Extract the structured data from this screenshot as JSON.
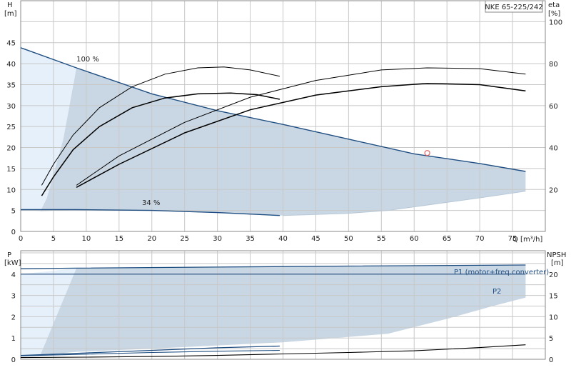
{
  "chart_data": [
    {
      "type": "line",
      "title": "NKE 65-225/242",
      "x_unit_label": "Q [m³/h]",
      "y_left_label": "H",
      "y_left_unit": "[m]",
      "y_right_label": "eta",
      "y_right_unit": "[%]",
      "xlim": [
        0,
        80
      ],
      "ylim_left": [
        0,
        55
      ],
      "ylim_right": [
        0,
        110
      ],
      "x_ticks": [
        "0",
        "5",
        "10",
        "15",
        "20",
        "25",
        "30",
        "35",
        "40",
        "45",
        "50",
        "55",
        "60",
        "65",
        "70",
        "75"
      ],
      "y_left_ticks": [
        "0",
        "5",
        "10",
        "15",
        "20",
        "25",
        "30",
        "35",
        "40",
        "45"
      ],
      "y_right_ticks": [
        "20",
        "40",
        "60",
        "80",
        "100"
      ],
      "grid": true,
      "colors": {
        "envelope": "#c9d7e4",
        "hydraulic_limit": "#e6f0fa",
        "curve": "#1f4e82",
        "eta": "#000000",
        "duty_point": "#e06060"
      },
      "annotations": [
        {
          "text": "100 %",
          "x": 8.5,
          "y": 40.5
        },
        {
          "text": "34 %",
          "x": 18.5,
          "y": 6.3
        }
      ],
      "series": [
        {
          "name": "100 %",
          "role": "head",
          "x": [
            0,
            8.5,
            20,
            30,
            40,
            50,
            60,
            70,
            77
          ],
          "y": [
            43.8,
            39,
            32.8,
            28.8,
            25.5,
            22,
            18.5,
            16.2,
            14.3
          ]
        },
        {
          "name": "34 %",
          "role": "head",
          "x": [
            0,
            8.5,
            20,
            30,
            39.5
          ],
          "y": [
            5.2,
            5.2,
            5,
            4.5,
            3.8
          ]
        },
        {
          "role": "eta",
          "x": [
            3.2,
            5,
            8,
            12,
            17,
            22,
            27,
            31,
            35,
            39.5
          ],
          "y": [
            11,
            16,
            23,
            29.5,
            34.5,
            37.5,
            39,
            39.2,
            38.5,
            37
          ]
        },
        {
          "role": "eta",
          "x": [
            3.2,
            5,
            8,
            12,
            17,
            22,
            27,
            32,
            36,
            39.5
          ],
          "y": [
            8.5,
            13,
            19.5,
            25,
            29.5,
            31.8,
            32.8,
            33,
            32.6,
            31.5
          ]
        },
        {
          "role": "eta",
          "x": [
            8.5,
            15,
            25,
            35,
            45,
            55,
            62,
            70,
            77
          ],
          "y": [
            11,
            18,
            26,
            32,
            36,
            38.5,
            39,
            38.8,
            37.5
          ]
        },
        {
          "role": "eta",
          "x": [
            8.5,
            15,
            25,
            35,
            45,
            55,
            62,
            70,
            77
          ],
          "y": [
            10.5,
            16,
            23.5,
            29,
            32.5,
            34.5,
            35.3,
            35,
            33.5
          ]
        }
      ],
      "envelope_lower": {
        "x": [
          3,
          8.5,
          20,
          39.5,
          40,
          50,
          56,
          70,
          77
        ],
        "y": [
          4.8,
          5.2,
          5,
          3.8,
          3.8,
          4.3,
          5,
          8,
          9.6
        ]
      },
      "duty_point": {
        "x": 62,
        "y": 18.7
      }
    },
    {
      "type": "line",
      "x_unit_label": "Q [m³/h]",
      "y_left_label": "P",
      "y_left_unit": "[kW]",
      "y_right_label": "NPSH",
      "y_right_unit": "[m]",
      "xlim": [
        0,
        80
      ],
      "ylim_left": [
        0,
        5.1
      ],
      "ylim_right": [
        0,
        25.5
      ],
      "y_left_ticks": [
        "0",
        "1",
        "2",
        "3",
        "4"
      ],
      "y_right_ticks": [
        "0",
        "5",
        "10",
        "15",
        "20"
      ],
      "grid": true,
      "series": [
        {
          "name": "P1 (motor+freq.converter)",
          "role": "power",
          "x": [
            0,
            8.5,
            30,
            50,
            77
          ],
          "y": [
            4.25,
            4.28,
            4.33,
            4.38,
            4.43
          ]
        },
        {
          "name": "P2",
          "role": "power",
          "x": [
            0,
            8.5,
            40,
            77
          ],
          "y": [
            4.0,
            4.0,
            4.0,
            4.0
          ]
        },
        {
          "role": "power_low",
          "x": [
            0,
            10,
            20,
            30,
            39.5
          ],
          "y": [
            0.18,
            0.3,
            0.42,
            0.54,
            0.62
          ]
        },
        {
          "role": "power_low",
          "x": [
            0,
            10,
            20,
            30,
            39.5
          ],
          "y": [
            0.16,
            0.24,
            0.32,
            0.38,
            0.42
          ]
        },
        {
          "role": "npsh",
          "x": [
            0,
            10,
            20,
            30,
            40,
            50,
            60,
            70,
            77
          ],
          "y": [
            0.08,
            0.1,
            0.13,
            0.18,
            0.25,
            0.32,
            0.4,
            0.55,
            0.68
          ]
        }
      ],
      "envelope_upper": {
        "x": [
          8.5,
          77
        ],
        "y": [
          4.28,
          4.43
        ]
      },
      "envelope_lower": {
        "x": [
          3,
          5,
          8.5,
          20,
          40,
          56,
          65,
          72,
          77
        ],
        "y": [
          0.2,
          0.25,
          0.35,
          0.5,
          0.8,
          1.2,
          1.9,
          2.5,
          2.9
        ]
      }
    }
  ]
}
